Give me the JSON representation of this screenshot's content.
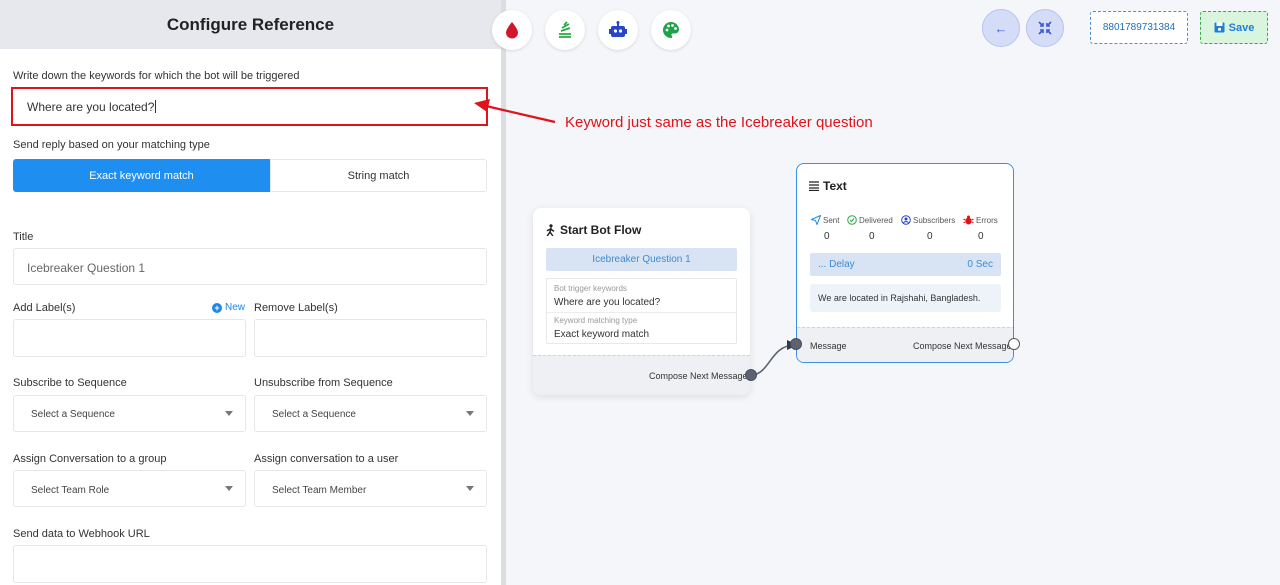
{
  "panel": {
    "title": "Configure Reference",
    "keywords_label": "Write down the keywords for which the bot will be triggered",
    "keywords_value": "Where are you located?",
    "match_type_label": "Send reply based on your matching type",
    "match_options": [
      "Exact keyword match",
      "String match"
    ],
    "title_label": "Title",
    "title_value": "Icebreaker Question 1",
    "add_labels_label": "Add Label(s)",
    "new_link": "New",
    "remove_labels_label": "Remove Label(s)",
    "subscribe_label": "Subscribe to Sequence",
    "subscribe_value": "Select a Sequence",
    "unsubscribe_label": "Unsubscribe from Sequence",
    "unsubscribe_value": "Select a Sequence",
    "assign_group_label": "Assign Conversation to a group",
    "assign_group_value": "Select Team Role",
    "assign_user_label": "Assign conversation to a user",
    "assign_user_value": "Select Team Member",
    "webhook_label": "Send data to Webhook URL"
  },
  "toolbar": {
    "phone": "8801789731384",
    "save_label": "Save",
    "colors": {
      "drop": "#d0172b",
      "stack": "#27a844",
      "robot": "#2546c8",
      "palette": "#1fa34a"
    }
  },
  "annotation": {
    "text": "Keyword just same as the Icebreaker question"
  },
  "start_node": {
    "title": "Start Bot Flow",
    "pill": "Icebreaker Question 1",
    "kw_label": "Bot trigger keywords",
    "kw_value": "Where are you located?",
    "match_label": "Keyword matching type",
    "match_value": "Exact keyword match",
    "footer": "Compose Next Message"
  },
  "text_node": {
    "title": "Text",
    "stats": [
      {
        "label": "Sent",
        "value": "0",
        "icon": "send-icon"
      },
      {
        "label": "Delivered",
        "value": "0",
        "icon": "check-circle-icon"
      },
      {
        "label": "Subscribers",
        "value": "0",
        "icon": "user-circle-icon"
      },
      {
        "label": "Errors",
        "value": "0",
        "icon": "bug-icon"
      }
    ],
    "delay_label": "... Delay",
    "delay_value": "0 Sec",
    "message": "We are located in Rajshahi, Bangladesh.",
    "footer_left": "Message",
    "footer_right": "Compose Next Message"
  }
}
